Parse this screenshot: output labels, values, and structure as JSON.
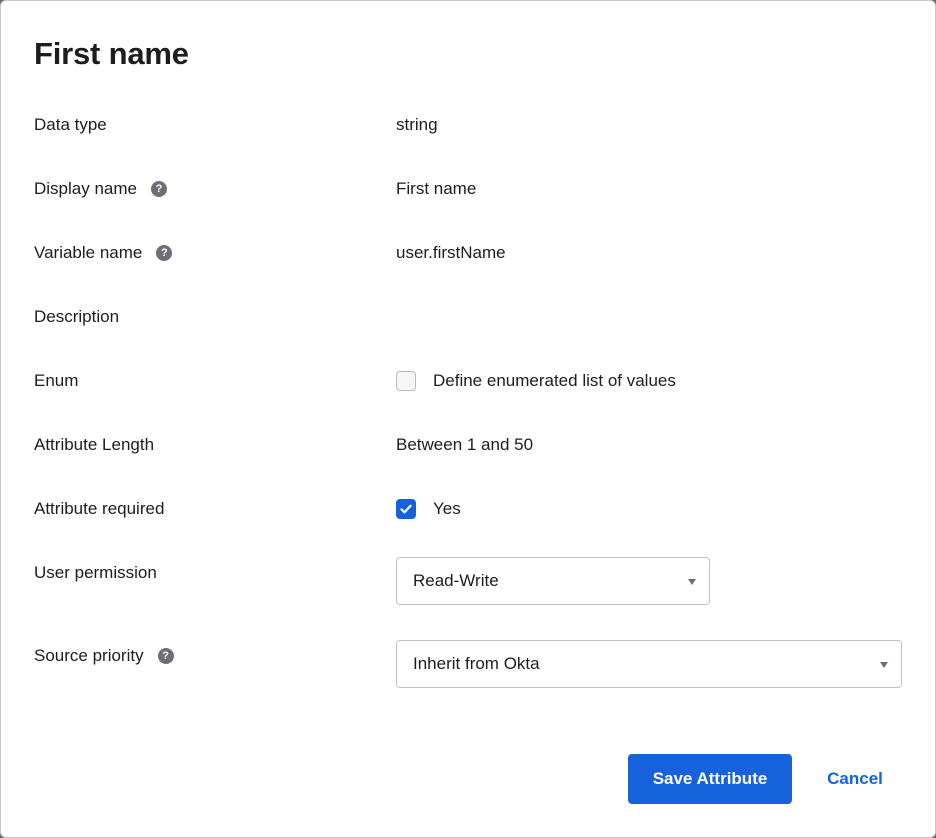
{
  "dialog": {
    "title": "First name"
  },
  "fields": {
    "data_type": {
      "label": "Data type",
      "value": "string"
    },
    "display_name": {
      "label": "Display name",
      "value": "First name",
      "help_icon": "question-circle-icon"
    },
    "variable_name": {
      "label": "Variable name",
      "value": "user.firstName",
      "help_icon": "question-circle-icon"
    },
    "description": {
      "label": "Description",
      "value": ""
    },
    "enum": {
      "label": "Enum",
      "checkbox_label": "Define enumerated list of values",
      "checked": false
    },
    "attribute_length": {
      "label": "Attribute Length",
      "value": "Between 1 and 50"
    },
    "attribute_required": {
      "label": "Attribute required",
      "checkbox_label": "Yes",
      "checked": true
    },
    "user_permission": {
      "label": "User permission",
      "selected": "Read-Write"
    },
    "source_priority": {
      "label": "Source priority",
      "selected": "Inherit from Okta",
      "help_icon": "question-circle-icon"
    }
  },
  "actions": {
    "save_label": "Save Attribute",
    "cancel_label": "Cancel"
  },
  "colors": {
    "primary": "#1662dd",
    "text": "#1d1d21",
    "help_icon": "#6e6e78"
  }
}
